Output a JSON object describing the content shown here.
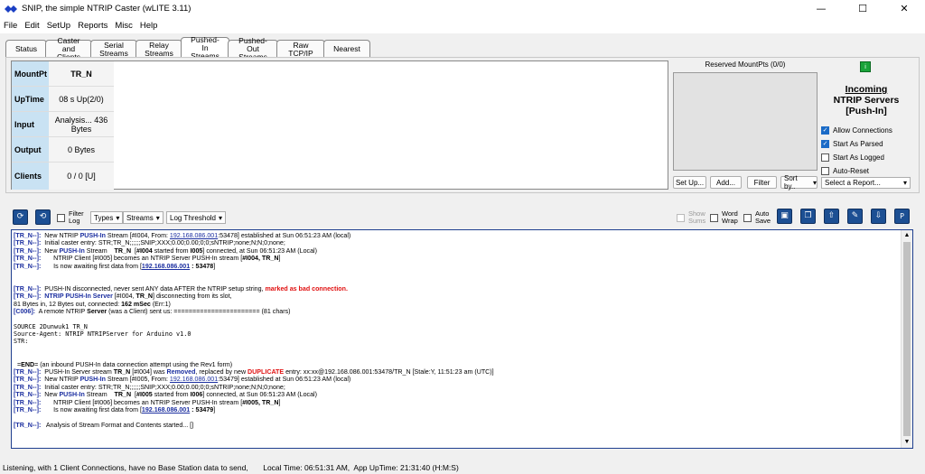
{
  "window": {
    "title": "SNIP, the simple NTRIP Caster  (wLITE 3.11)",
    "minimize": "—",
    "maximize": "☐",
    "close": "✕"
  },
  "menu": [
    "File",
    "Edit",
    "SetUp",
    "Reports",
    "Misc",
    "Help"
  ],
  "tabs": [
    {
      "l1": "Status",
      "l2": ""
    },
    {
      "l1": "Caster",
      "l2": "and Clients"
    },
    {
      "l1": "Serial",
      "l2": "Streams"
    },
    {
      "l1": "Relay",
      "l2": "Streams"
    },
    {
      "l1": "Pushed-In",
      "l2": "Streams"
    },
    {
      "l1": "Pushed-Out",
      "l2": "Streams"
    },
    {
      "l1": "Raw",
      "l2": "TCP/IP"
    },
    {
      "l1": "Nearest",
      "l2": ""
    }
  ],
  "info": {
    "mountpt_label": "MountPt",
    "mountpt_value": "TR_N",
    "uptime_label": "UpTime",
    "uptime_value": "08 s Up(2/0)",
    "input_label": "Input",
    "input_value": "Analysis... 436 Bytes",
    "output_label": "Output",
    "output_value": "0 Bytes",
    "clients_label": "Clients",
    "clients_value": "0 / 0 [U]"
  },
  "reserved": {
    "label": "Reserved MountPts (0/0)",
    "setup": "Set Up...",
    "add": "Add...",
    "filter": "Filter",
    "sortby": "Sort by..",
    "report": "Select a Report..."
  },
  "incoming": {
    "info_btn": "i",
    "line1": "Incoming",
    "line2": "NTRIP Servers",
    "line3": "[Push-In]",
    "options": [
      {
        "label": "Allow Connections",
        "checked": true
      },
      {
        "label": "Start As Parsed",
        "checked": true
      },
      {
        "label": "Start As Logged",
        "checked": false
      },
      {
        "label": "Auto-Reset",
        "checked": false
      }
    ]
  },
  "toolbar": {
    "filter_log": "Filter Log",
    "types": "Types",
    "streams": "Streams",
    "log_threshold": "Log Threshold",
    "show_sums": "Show Sums",
    "word_wrap": "Word Wrap",
    "auto_save": "Auto Save"
  },
  "log": {
    "l01_tag": "[TR_N--]:",
    "l01_a": "  New NTRIP ",
    "l01_b": "PUSH-In",
    "l01_c": " Stream [#I004, From: ",
    "l01_d": "192.168.086.001",
    "l01_e": ":53478] established at Sun 06:51:23 AM (local)",
    "l02_tag": "[TR_N--]:",
    "l02_a": "  Initial caster entry: STR;TR_N;;;;;;SNIP;XXX;0.00;0.00;0;0;sNTRIP;none;N;N;0;none;",
    "l03_tag": "[TR_N--]:",
    "l03_a": "  New ",
    "l03_b": "PUSH-In",
    "l03_c": " Stream    ",
    "l03_d": "TR_N",
    "l03_e": "  [",
    "l03_f": "#I004",
    "l03_g": " started from ",
    "l03_h": "I005",
    "l03_i": "] connected, at Sun 06:51:23 AM (Local)",
    "l04_tag": "[TR_N--]:",
    "l04_a": "       NTRIP Client [#I005] becomes an NTRIP Server PUSH-In stream [",
    "l04_b": "#I004, TR_N",
    "l04_c": "]",
    "l05_tag": "[TR_N--]:",
    "l05_a": "       Is now awaiting first data from [",
    "l05_b": "192.168.086.001",
    "l05_c": " : ",
    "l05_d": "53478",
    "l05_e": "]",
    "l06_tag": "[TR_N--]:",
    "l06_a": "  PUSH-IN disconnected, never sent ANY data AFTER the NTRIP setup string, ",
    "l06_b": "marked as bad connection.",
    "l07_tag": "[TR_N--]:",
    "l07_a": "  ",
    "l07_b": "NTRIP PUSH-In Server",
    "l07_c": " [#I004, ",
    "l07_d": "TR_N",
    "l07_e": "] disconnecting from its slot,",
    "l08_a": "81 Bytes in, 12 Bytes out, connected: ",
    "l08_b": "162 mSec",
    "l08_c": " (Err:1)",
    "l09_tag": "[C006]:",
    "l09_a": "  A remote NTRIP ",
    "l09_b": "Server",
    "l09_c": " (was a Client) sent us: ======================= (81 chars)",
    "l10": "SOURCE 2Dunwuk1 TR_N",
    "l11": "Source-Agent: NTRIP NTRIPServer for Arduino v1.0",
    "l12": "STR:",
    "l13_a": "  =",
    "l13_b": "END",
    "l13_c": "= (an inbound PUSH-In data connection attempt using the Rev1 form)",
    "l14_tag": "[TR_N--]:",
    "l14_a": "  PUSH-In Server stream ",
    "l14_b": "TR_N",
    "l14_c": " [#I004] was ",
    "l14_d": "Removed",
    "l14_e": ", replaced by new ",
    "l14_f": "DUPLICATE",
    "l14_g": " entry: xx:xx@192.168.086.001:53478/TR_N [Stale:Y, 11:51:23 am (UTC)]",
    "l15_tag": "[TR_N--]:",
    "l15_a": "  New NTRIP ",
    "l15_b": "PUSH-In",
    "l15_c": " Stream [#I005, From: ",
    "l15_d": "192.168.086.001",
    "l15_e": ":53479] established at Sun 06:51:23 AM (local)",
    "l16_tag": "[TR_N--]:",
    "l16_a": "  Initial caster entry: STR;TR_N;;;;;;SNIP;XXX;0.00;0.00;0;0;sNTRIP;none;N;N;0;none;",
    "l17_tag": "[TR_N--]:",
    "l17_a": "  New ",
    "l17_b": "PUSH-In",
    "l17_c": " Stream    ",
    "l17_d": "TR_N",
    "l17_e": "  [",
    "l17_f": "#I005",
    "l17_g": " started from ",
    "l17_h": "I006",
    "l17_i": "] connected, at Sun 06:51:23 AM (Local)",
    "l18_tag": "[TR_N--]:",
    "l18_a": "       NTRIP Client [#I006] becomes an NTRIP Server PUSH-In stream [",
    "l18_b": "#I005, TR_N",
    "l18_c": "]",
    "l19_tag": "[TR_N--]:",
    "l19_a": "       Is now awaiting first data from [",
    "l19_b": "192.168.086.001",
    "l19_c": " : ",
    "l19_d": "53479",
    "l19_e": "]",
    "l20_tag": "[TR_N--]:",
    "l20_a": "   Analysis of Stream Format and Contents started... []"
  },
  "status": {
    "text": "Listening, with 1 Client Connections, have no Base Station data to send,       Local Time: 06:51:31 AM,  App UpTime: 21:31:40 (H:M:S)"
  },
  "colors": {
    "accent": "#1c4f93",
    "label_bg": "#c9e2f3",
    "log_blue": "#1c2fa0",
    "log_red": "#e01010",
    "info_green": "#1aa33a"
  }
}
